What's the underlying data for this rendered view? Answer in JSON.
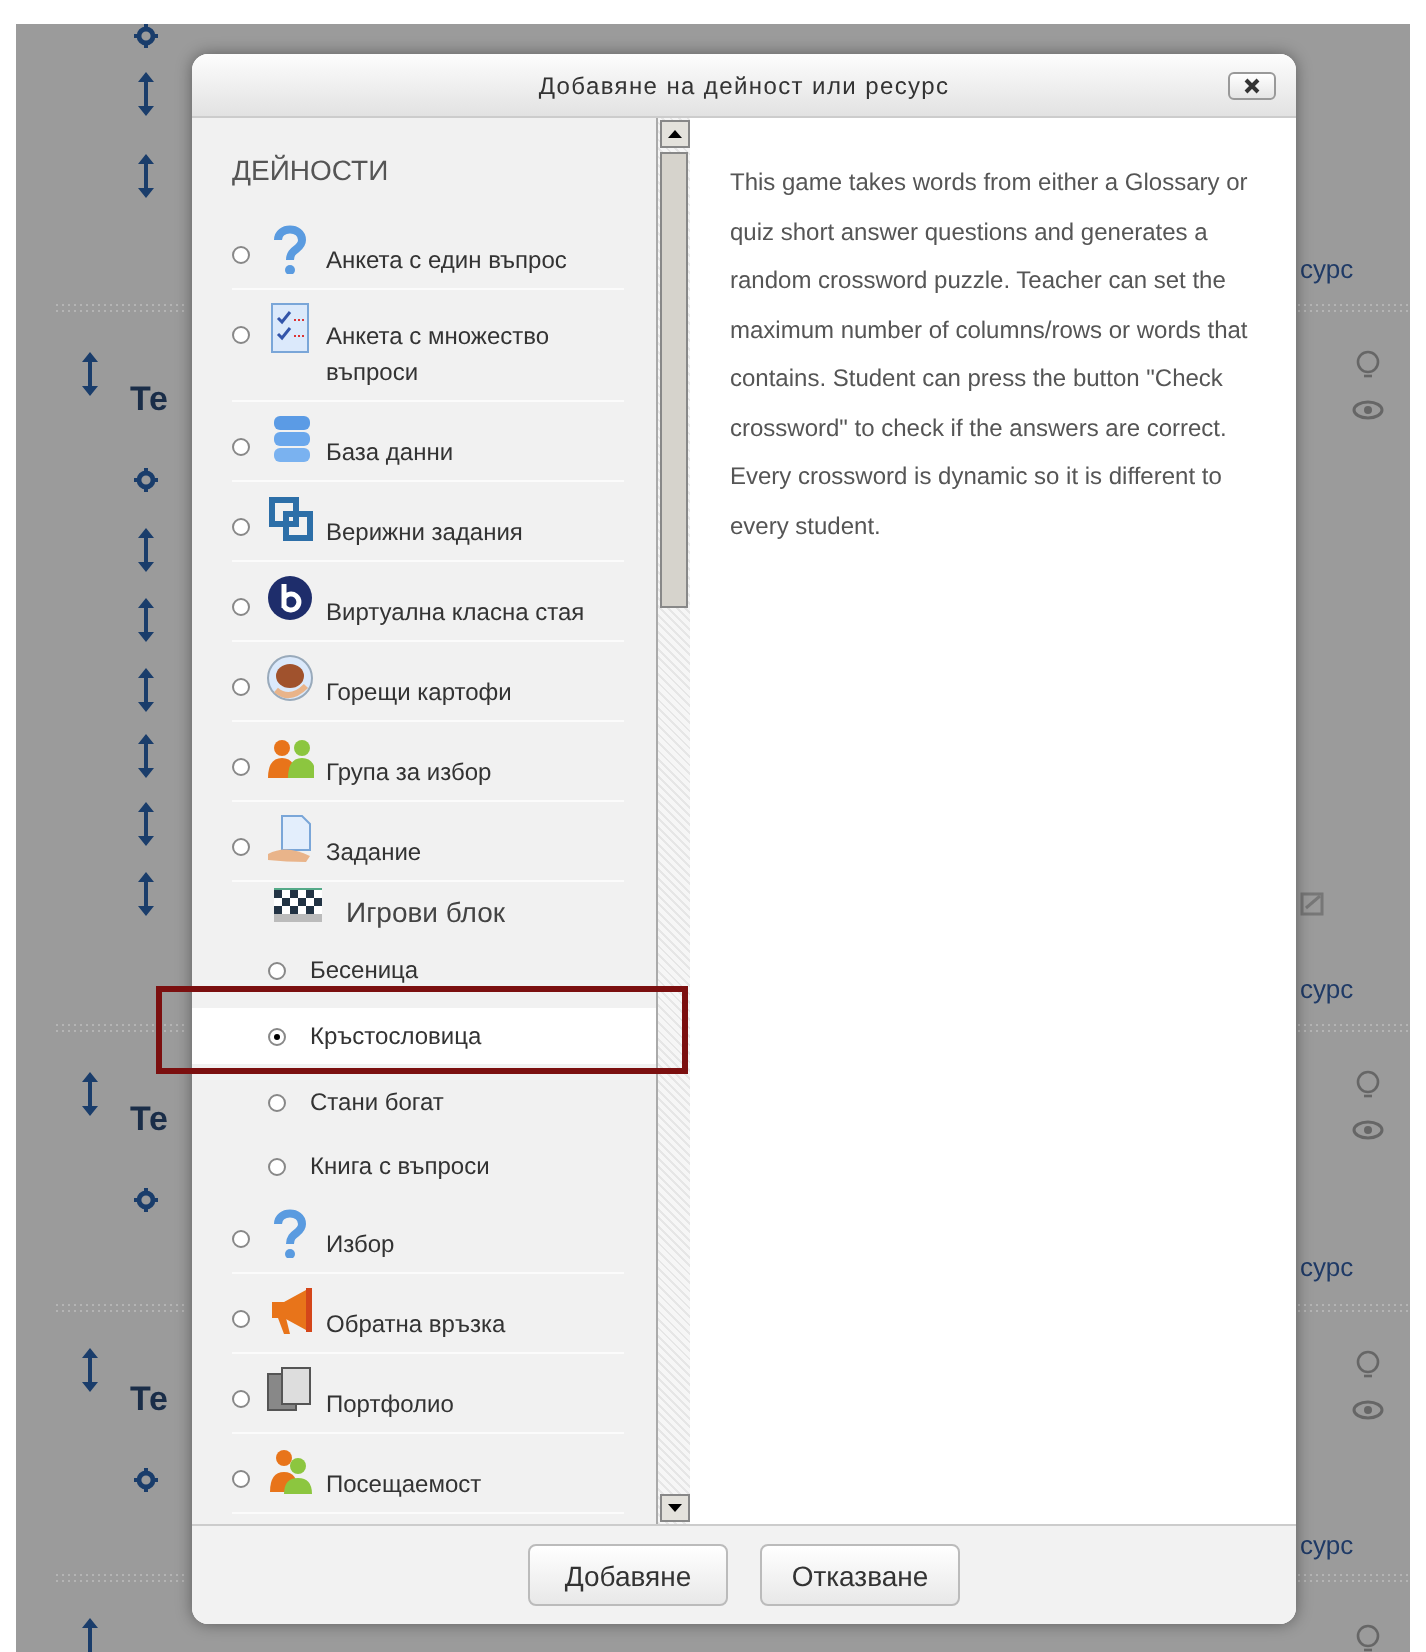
{
  "background": {
    "headings": [
      "Те",
      "Те",
      "Те"
    ],
    "links": [
      "сурс",
      "сурс",
      "сурс",
      "сурс"
    ]
  },
  "dialog": {
    "title": "Добавяне на дейност или ресурс",
    "section_heading": "ДЕЙНОСТИ",
    "options": [
      {
        "kind": "option",
        "label": "Анкета с един въпрос",
        "selected": false
      },
      {
        "kind": "option",
        "label": "Анкета с множество въпроси",
        "selected": false
      },
      {
        "kind": "option",
        "label": "База данни",
        "selected": false
      },
      {
        "kind": "option",
        "label": "Верижни задания",
        "selected": false
      },
      {
        "kind": "option",
        "label": "Виртуална класна стая",
        "selected": false
      },
      {
        "kind": "option",
        "label": "Горещи картофи",
        "selected": false
      },
      {
        "kind": "option",
        "label": "Група за избор",
        "selected": false
      },
      {
        "kind": "option",
        "label": "Задание",
        "selected": false
      },
      {
        "kind": "group",
        "label": "Игрови блок",
        "children": [
          {
            "label": "Бесеница",
            "selected": false
          },
          {
            "label": "Кръстословица",
            "selected": true
          },
          {
            "label": "Стани богат",
            "selected": false
          },
          {
            "label": "Книга с въпроси",
            "selected": false
          }
        ]
      },
      {
        "kind": "option",
        "label": "Избор",
        "selected": false
      },
      {
        "kind": "option",
        "label": "Обратна връзка",
        "selected": false
      },
      {
        "kind": "option",
        "label": "Портфолио",
        "selected": false
      },
      {
        "kind": "option",
        "label": "Посещаемост",
        "selected": false
      }
    ],
    "description": "This game takes words from either a Glossary or quiz short answer questions and generates a random crossword puzzle. Teacher can set the maximum number of columns/rows or words that contains. Student can press the button \"Check crossword\" to check if the answers are correct. Every crossword is dynamic so it is different to every student.",
    "buttons": [
      "Добавяне",
      "Отказване"
    ]
  }
}
